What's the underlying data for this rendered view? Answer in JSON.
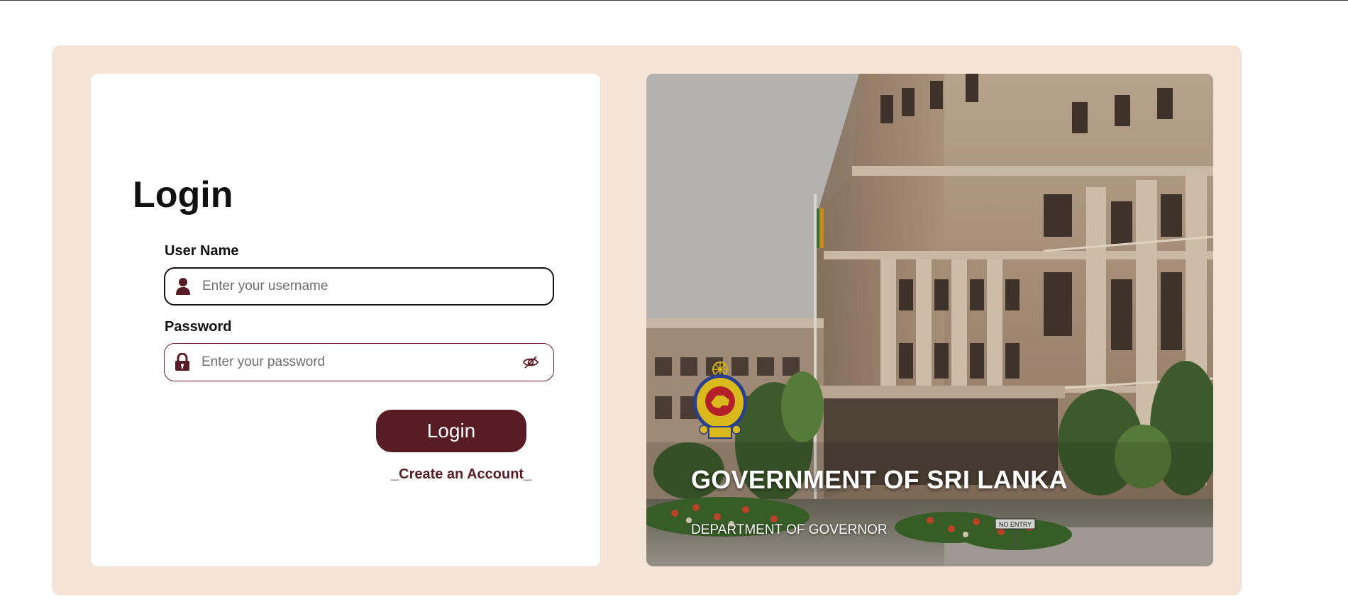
{
  "login_form": {
    "title": "Login",
    "username_label": "User Name",
    "username_placeholder": "Enter your username",
    "username_value": "",
    "password_label": "Password",
    "password_placeholder": "Enter your password",
    "password_value": "",
    "submit_label": "Login",
    "create_account_label": "_Create an Account_"
  },
  "hero": {
    "title": "GOVERNMENT OF SRI LANKA",
    "subtitle": "DEPARTMENT OF GOVERNOR",
    "sign_text": "NO ENTRY"
  },
  "icons": {
    "username": "user-icon",
    "password": "lock-icon",
    "password_toggle": "eye-off-icon",
    "emblem": "sri-lanka-emblem"
  },
  "colors": {
    "panel_background": "#f4e4d8",
    "brand_maroon": "#571c24",
    "card_background": "#ffffff"
  }
}
